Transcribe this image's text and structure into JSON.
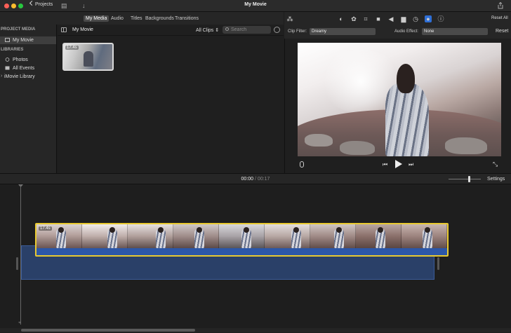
{
  "window": {
    "title": "My Movie",
    "projects_label": "Projects"
  },
  "media_tabs": [
    {
      "label": "My Media",
      "active": true
    },
    {
      "label": "Audio",
      "active": false
    },
    {
      "label": "Titles",
      "active": false
    },
    {
      "label": "Backgrounds",
      "active": false
    },
    {
      "label": "Transitions",
      "active": false
    }
  ],
  "sidebar": {
    "project_media_heading": "PROJECT MEDIA",
    "project_item": "My Movie",
    "libraries_heading": "LIBRARIES",
    "library_items": [
      "Photos",
      "All Events"
    ],
    "imovie_library": "iMovie Library"
  },
  "browser": {
    "title": "My Movie",
    "clips_filter": "All Clips",
    "search_placeholder": "Search",
    "clip_duration": "17.4s"
  },
  "viewer_toolbar": {
    "icons": [
      "magic-wand-icon",
      "color-balance-icon",
      "color-correction-icon",
      "crop-icon",
      "stabilization-icon",
      "volume-icon",
      "noise-reduction-icon",
      "speed-icon",
      "clip-filter-icon",
      "info-icon"
    ],
    "active_icon": "clip-filter-icon",
    "reset_all_label": "Reset All"
  },
  "adjustments": {
    "clip_filter_label": "Clip Filter:",
    "clip_filter_value": "Dreamy",
    "audio_effect_label": "Audio Effect:",
    "audio_effect_value": "None",
    "reset_label": "Reset"
  },
  "timeline": {
    "current_time": "00:00",
    "separator": "/",
    "total_time": "00:17",
    "settings_label": "Settings",
    "clip_duration": "17.4s",
    "frame_count": 9
  },
  "colors": {
    "accent": "#2f6fd6",
    "clip_selection": "#e8c930",
    "audio_track": "#2a4068"
  }
}
